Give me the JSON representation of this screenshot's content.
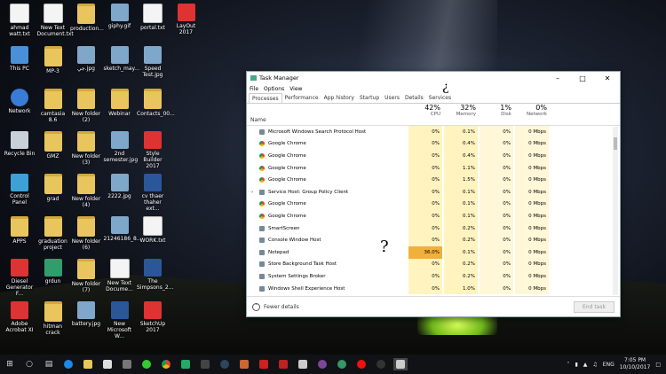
{
  "desktop_icons": [
    {
      "label": "ahmad\nwatt.txt",
      "icon": "text-file-icon",
      "col": 0,
      "row": 0
    },
    {
      "label": "New Text\nDocument.txt",
      "icon": "text-file-icon",
      "col": 1,
      "row": 0
    },
    {
      "label": "production...",
      "icon": "folder-icon",
      "col": 2,
      "row": 0
    },
    {
      "label": "giphy.gif",
      "icon": "image-file-icon",
      "col": 3,
      "row": 0
    },
    {
      "label": "portal.txt",
      "icon": "text-file-icon",
      "col": 4,
      "row": 0
    },
    {
      "label": "LayOut 2017",
      "icon": "layout-app-icon",
      "col": 5,
      "row": 0
    },
    {
      "label": "This PC",
      "icon": "computer-icon",
      "col": 0,
      "row": 1
    },
    {
      "label": "MP-3",
      "icon": "folder-icon",
      "col": 1,
      "row": 1
    },
    {
      "label": "جي.jpg",
      "icon": "image-file-icon",
      "col": 2,
      "row": 1
    },
    {
      "label": "sketch_may...",
      "icon": "image-file-icon",
      "col": 3,
      "row": 1
    },
    {
      "label": "Speed\nTest.jpg",
      "icon": "image-file-icon",
      "col": 4,
      "row": 1
    },
    {
      "label": "Network",
      "icon": "network-icon",
      "col": 0,
      "row": 2
    },
    {
      "label": "camtasia 8.6",
      "icon": "folder-icon",
      "col": 1,
      "row": 2
    },
    {
      "label": "New folder\n(2)",
      "icon": "folder-icon",
      "col": 2,
      "row": 2
    },
    {
      "label": "Webinar",
      "icon": "folder-icon",
      "col": 3,
      "row": 2
    },
    {
      "label": "Contacts_00...",
      "icon": "folder-icon",
      "col": 4,
      "row": 2
    },
    {
      "label": "Recycle Bin",
      "icon": "recycle-bin-icon",
      "col": 0,
      "row": 3
    },
    {
      "label": "GMZ",
      "icon": "folder-icon",
      "col": 1,
      "row": 3
    },
    {
      "label": "New folder\n(3)",
      "icon": "folder-icon",
      "col": 2,
      "row": 3
    },
    {
      "label": "2nd\nsemester.jpg",
      "icon": "image-file-icon",
      "col": 3,
      "row": 3
    },
    {
      "label": "Style Builder\n2017",
      "icon": "style-builder-app-icon",
      "col": 4,
      "row": 3
    },
    {
      "label": "Control Panel",
      "icon": "control-panel-icon",
      "col": 0,
      "row": 4
    },
    {
      "label": "grad",
      "icon": "folder-icon",
      "col": 1,
      "row": 4
    },
    {
      "label": "New folder\n(4)",
      "icon": "folder-icon",
      "col": 2,
      "row": 4
    },
    {
      "label": "2222.jpg",
      "icon": "image-file-icon",
      "col": 3,
      "row": 4
    },
    {
      "label": "cv thaer\nthaher ext...",
      "icon": "word-doc-icon",
      "col": 4,
      "row": 4
    },
    {
      "label": "APPS",
      "icon": "folder-icon",
      "col": 0,
      "row": 5
    },
    {
      "label": "graduation\nproject",
      "icon": "folder-icon",
      "col": 1,
      "row": 5
    },
    {
      "label": "New folder\n(6)",
      "icon": "folder-icon",
      "col": 2,
      "row": 5
    },
    {
      "label": "21246186_8...",
      "icon": "image-file-icon",
      "col": 3,
      "row": 5
    },
    {
      "label": "WORK.txt",
      "icon": "text-file-icon",
      "col": 4,
      "row": 5
    },
    {
      "label": "Diesel\nGenerator F...",
      "icon": "pdf-file-icon",
      "col": 0,
      "row": 6
    },
    {
      "label": "grdun",
      "icon": "green-app-icon",
      "col": 1,
      "row": 6
    },
    {
      "label": "New folder\n(7)",
      "icon": "folder-icon",
      "col": 2,
      "row": 6
    },
    {
      "label": "New Text\nDocume...",
      "icon": "text-file-icon",
      "col": 3,
      "row": 6
    },
    {
      "label": "The\nSimpsons_2...",
      "icon": "archive-icon",
      "col": 4,
      "row": 6
    },
    {
      "label": "Adobe\nAcrobat XI",
      "icon": "acrobat-icon",
      "col": 0,
      "row": 7
    },
    {
      "label": "hitman crack",
      "icon": "folder-icon",
      "col": 1,
      "row": 7
    },
    {
      "label": "battery.jpg",
      "icon": "image-file-icon",
      "col": 2,
      "row": 7
    },
    {
      "label": "New\nMicrosoft W...",
      "icon": "word-doc-icon",
      "col": 3,
      "row": 7
    },
    {
      "label": "SketchUp\n2017",
      "icon": "sketchup-icon",
      "col": 4,
      "row": 7
    }
  ],
  "task_manager": {
    "title": "Task Manager",
    "menu": [
      "File",
      "Options",
      "View"
    ],
    "tabs": [
      "Processes",
      "Performance",
      "App history",
      "Startup",
      "Users",
      "Details",
      "Services"
    ],
    "header": {
      "name": "Name",
      "cpu_pct": "42%",
      "cpu": "CPU",
      "mem_pct": "32%",
      "mem": "Memory",
      "disk_pct": "1%",
      "disk": "Disk",
      "net_pct": "0%",
      "net": "Network"
    },
    "rows": [
      {
        "name": "Microsoft Windows Search Protocol Host",
        "cpu": "0%",
        "mem": "0.1%",
        "disk": "0%",
        "net": "0 Mbps",
        "icon": "search-host-icon"
      },
      {
        "name": "Google Chrome",
        "cpu": "0%",
        "mem": "0.4%",
        "disk": "0%",
        "net": "0 Mbps",
        "icon": "chrome-icon"
      },
      {
        "name": "Google Chrome",
        "cpu": "0%",
        "mem": "0.4%",
        "disk": "0%",
        "net": "0 Mbps",
        "icon": "chrome-icon"
      },
      {
        "name": "Google Chrome",
        "cpu": "0%",
        "mem": "1.1%",
        "disk": "0%",
        "net": "0 Mbps",
        "icon": "chrome-icon"
      },
      {
        "name": "Google Chrome",
        "cpu": "0%",
        "mem": "1.5%",
        "disk": "0%",
        "net": "0 Mbps",
        "icon": "chrome-icon"
      },
      {
        "name": "Service Host: Group Policy Client",
        "cpu": "0%",
        "mem": "0.1%",
        "disk": "0%",
        "net": "0 Mbps",
        "icon": "service-host-icon",
        "expandable": true
      },
      {
        "name": "Google Chrome",
        "cpu": "0%",
        "mem": "0.1%",
        "disk": "0%",
        "net": "0 Mbps",
        "icon": "chrome-icon"
      },
      {
        "name": "Google Chrome",
        "cpu": "0%",
        "mem": "0.1%",
        "disk": "0%",
        "net": "0 Mbps",
        "icon": "chrome-icon"
      },
      {
        "name": "SmartScreen",
        "cpu": "0%",
        "mem": "0.2%",
        "disk": "0%",
        "net": "0 Mbps",
        "icon": "smartscreen-icon"
      },
      {
        "name": "Console Window Host",
        "cpu": "0%",
        "mem": "0.2%",
        "disk": "0%",
        "net": "0 Mbps",
        "icon": "console-icon"
      },
      {
        "name": "Notepad",
        "cpu": "36.0%",
        "mem": "0.1%",
        "disk": "0%",
        "net": "0 Mbps",
        "icon": "notepad-icon",
        "hot": true
      },
      {
        "name": "Store Background Task Host",
        "cpu": "0%",
        "mem": "0.2%",
        "disk": "0%",
        "net": "0 Mbps",
        "icon": "store-icon"
      },
      {
        "name": "System Settings Broker",
        "cpu": "0%",
        "mem": "0.2%",
        "disk": "0%",
        "net": "0 Mbps",
        "icon": "settings-icon"
      },
      {
        "name": "Windows Shell Experience Host",
        "cpu": "0%",
        "mem": "1.0%",
        "disk": "0%",
        "net": "0 Mbps",
        "icon": "shell-icon"
      }
    ],
    "fewer_details": "Fewer details",
    "end_task": "End task"
  },
  "annotations": {
    "mark1": "¿",
    "mark2": "?"
  },
  "taskbar": {
    "tray_lang": "ENG",
    "time": "7:05 PM",
    "date": "10/10/2017"
  }
}
